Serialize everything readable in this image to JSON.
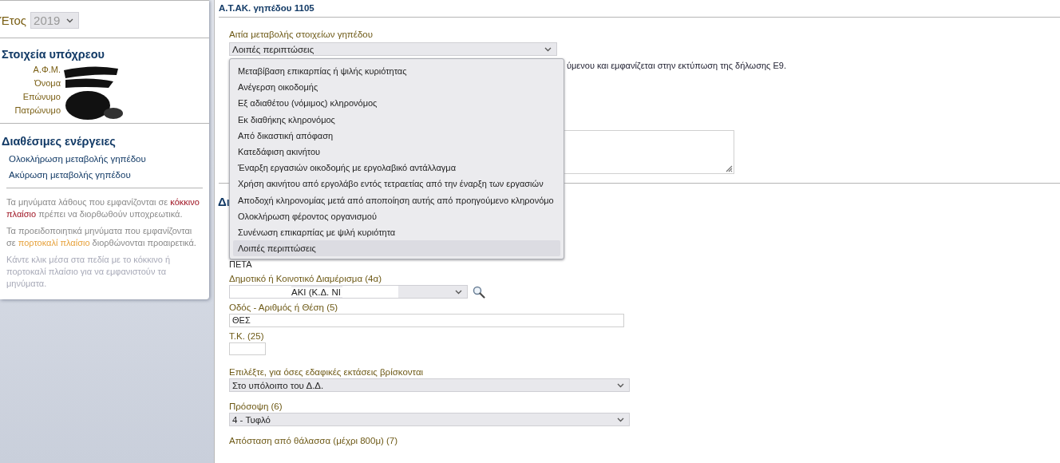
{
  "sidebar": {
    "year_label": "Έτος",
    "year": "2019",
    "taxpayer_heading": "Στοιχεία υπόχρεου",
    "taxpayer_fields": [
      {
        "label": "Α.Φ.Μ."
      },
      {
        "label": "Όνομα"
      },
      {
        "label": "Επώνυμο"
      },
      {
        "label": "Πατρώνυμο"
      }
    ],
    "actions_heading": "Διαθέσιμες ενέργειες",
    "actions": [
      "Ολοκλήρωση μεταβολής γηπέδου",
      "Ακύρωση μεταβολής γηπέδου"
    ],
    "messages": [
      {
        "kind": "note",
        "parts": [
          {
            "text": "Τα μηνύματα λάθους που εμφανίζονται σε ",
            "kind": "plain"
          },
          {
            "text": "κόκκινο πλαίσιο",
            "kind": "error"
          },
          {
            "text": " πρέπει να διορθωθούν υποχρεωτικά.",
            "kind": "plain"
          }
        ]
      },
      {
        "kind": "note",
        "parts": [
          {
            "text": "Τα προειδοποιητικά μηνύματα που εμφανίζονται σε ",
            "kind": "plain"
          },
          {
            "text": "πορτοκαλί πλαίσιο",
            "kind": "warning"
          },
          {
            "text": " διορθώνονται προαιρετικά.",
            "kind": "plain"
          }
        ]
      },
      {
        "kind": "hint",
        "parts": [
          {
            "text": "Κάντε κλικ μέσα στα πεδία με το κόκκινο ή πορτοκαλί πλαίσιο για να εμφανιστούν τα μηνύματα.",
            "kind": "plain"
          }
        ]
      }
    ]
  },
  "main": {
    "title": "Α.Τ.ΑΚ. γηπέδου 1105",
    "cause_label": "Αιτία μεταβολής στοιχείων γηπέδου",
    "cause_value": "Λοιπές περιπτώσεις",
    "cause_options": [
      {
        "label": "Μεταβίβαση επικαρπίας ή ψιλής κυριότητας",
        "selected": false
      },
      {
        "label": "Ανέγερση οικοδομής",
        "selected": false
      },
      {
        "label": "Εξ αδιαθέτου (νόμιμος) κληρονόμος",
        "selected": false
      },
      {
        "label": "Εκ διαθήκης κληρονόμος",
        "selected": false
      },
      {
        "label": "Από δικαστική απόφαση",
        "selected": false
      },
      {
        "label": "Κατεδάφιση ακινήτου",
        "selected": false
      },
      {
        "label": "Έναρξη εργασιών οικοδομής με εργολαβικό αντάλλαγμα",
        "selected": false
      },
      {
        "label": "Χρήση ακινήτου από εργολάβο εντός τετραετίας από την έναρξη των εργασιών",
        "selected": false
      },
      {
        "label": "Αποδοχή κληρονομίας μετά από αποποίηση αυτής από προηγούμενο κληρονόμο",
        "selected": false
      },
      {
        "label": "Ολοκλήρωση φέροντος οργανισμού",
        "selected": false
      },
      {
        "label": "Συνένωση επικαρπίας με ψιλή κυριότητα",
        "selected": false
      },
      {
        "label": "Λοιπές περιπτώσεις",
        "selected": true
      }
    ],
    "info_text": "ύμενου και εμφανίζεται στην εκτύπωση της δήλωσης Ε9.",
    "section_heading": "Δι",
    "partial_value": "ΠΕΤΑ",
    "fields": [
      {
        "kind": "combo",
        "label": "Δημοτικό ή Κοινοτικό Διαμέρισμα (4α)",
        "value": "ΑΚΙ (Κ.Δ. ΝΙ"
      },
      {
        "kind": "text",
        "label": "Οδός - Αριθμός ή Θέση (5)",
        "value": "ΘΕΣ"
      },
      {
        "kind": "short",
        "label": "Τ.Κ. (25)"
      },
      {
        "kind": "select",
        "label": "Επιλέξτε, για όσες εδαφικές εκτάσεις βρίσκονται",
        "value": "Στο υπόλοιπο του Δ.Δ."
      },
      {
        "kind": "select",
        "label": "Πρόσοψη (6)",
        "value": "4 - Τυφλό"
      },
      {
        "kind": "label",
        "label": "Απόσταση από θάλασσα (μέχρι 800μ) (7)"
      }
    ]
  }
}
